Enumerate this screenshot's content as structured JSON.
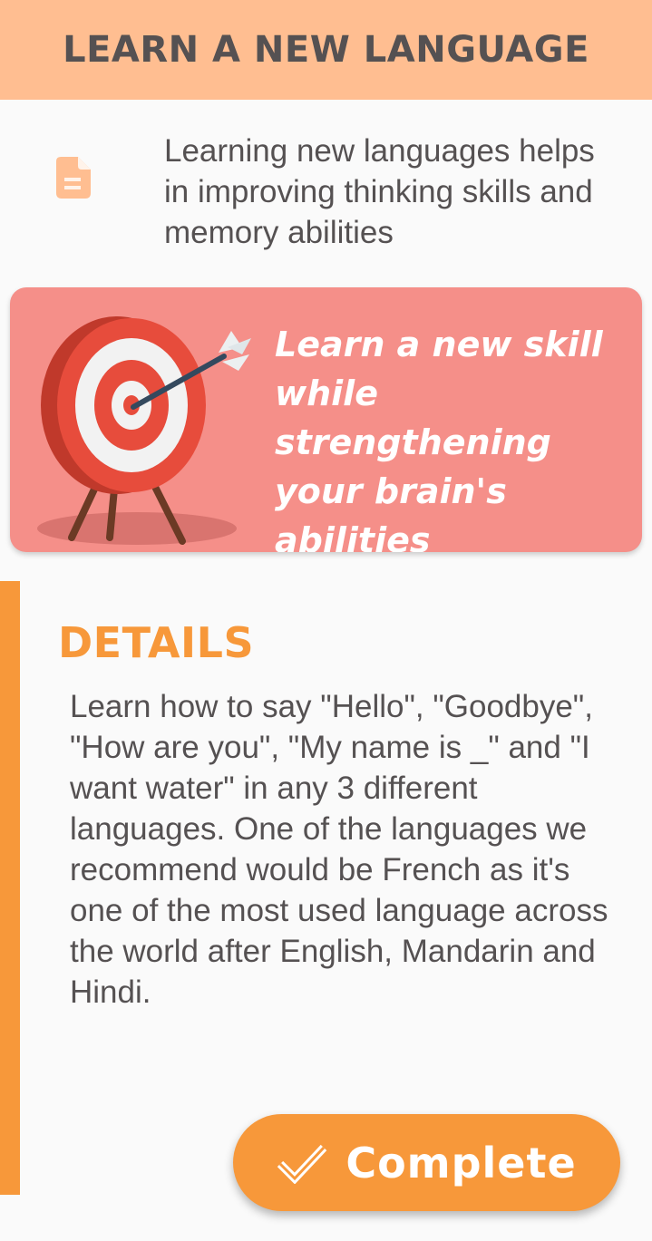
{
  "header": {
    "title": "LEARN A NEW LANGUAGE"
  },
  "intro": {
    "icon": "document-icon",
    "text": "Learning new languages helps in improving thinking skills and memory abilities"
  },
  "banner": {
    "image": "archery-target-with-arrow",
    "text": "Learn a new skill while strengthening your brain's abilities"
  },
  "details": {
    "heading": "DETAILS",
    "body": "Learn how to say \"Hello\", \"Goodbye\", \"How are you\", \"My name is _\" and \"I want water\" in any 3 different languages. One of the languages we recommend would be French as it's one of the most used language across the world after English, Mandarin and Hindi."
  },
  "actions": {
    "complete_label": "Complete",
    "complete_icon": "check-icon"
  },
  "colors": {
    "header_bg": "#ffbe91",
    "banner_bg": "#f58f89",
    "accent": "#f7983a",
    "text": "#555152",
    "background": "#fafafa"
  }
}
